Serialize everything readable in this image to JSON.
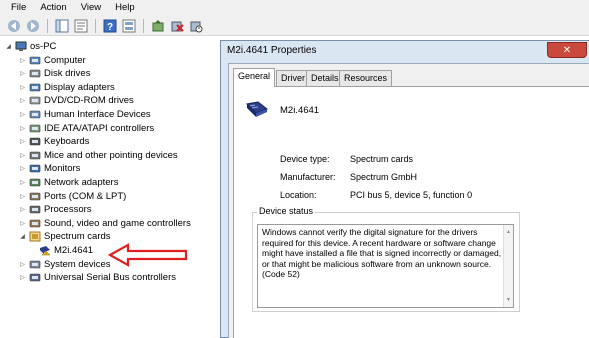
{
  "menubar": {
    "items": [
      "File",
      "Action",
      "View",
      "Help"
    ]
  },
  "toolbar": {
    "buttons": [
      "back-icon",
      "forward-icon",
      "show-hide-tree-icon",
      "properties-icon",
      "help-icon",
      "view-icon",
      "update-driver-icon",
      "uninstall-icon",
      "disable-icon"
    ]
  },
  "tree": {
    "root": "os-PC",
    "items": [
      {
        "label": "Computer",
        "icon": "computer-icon",
        "expanded": false
      },
      {
        "label": "Disk drives",
        "icon": "disk-drive-icon",
        "expanded": false
      },
      {
        "label": "Display adapters",
        "icon": "display-adapter-icon",
        "expanded": false
      },
      {
        "label": "DVD/CD-ROM drives",
        "icon": "dvd-drive-icon",
        "expanded": false
      },
      {
        "label": "Human Interface Devices",
        "icon": "hid-icon",
        "expanded": false
      },
      {
        "label": "IDE ATA/ATAPI controllers",
        "icon": "ide-controller-icon",
        "expanded": false
      },
      {
        "label": "Keyboards",
        "icon": "keyboard-icon",
        "expanded": false
      },
      {
        "label": "Mice and other pointing devices",
        "icon": "mouse-icon",
        "expanded": false
      },
      {
        "label": "Monitors",
        "icon": "monitor-icon",
        "expanded": false
      },
      {
        "label": "Network adapters",
        "icon": "network-adapter-icon",
        "expanded": false
      },
      {
        "label": "Ports (COM & LPT)",
        "icon": "port-icon",
        "expanded": false
      },
      {
        "label": "Processors",
        "icon": "processor-icon",
        "expanded": false
      },
      {
        "label": "Sound, video and game controllers",
        "icon": "sound-icon",
        "expanded": false
      },
      {
        "label": "Spectrum cards",
        "icon": "spectrum-card-icon",
        "expanded": true
      },
      {
        "label": "M2i.4641",
        "icon": "warning-device-icon",
        "child": true
      },
      {
        "label": "System devices",
        "icon": "system-device-icon",
        "expanded": false
      },
      {
        "label": "Universal Serial Bus controllers",
        "icon": "usb-icon",
        "expanded": false
      }
    ]
  },
  "dialog": {
    "title": "M2i.4641 Properties",
    "close_label": "✕",
    "tabs": [
      "General",
      "Driver",
      "Details",
      "Resources"
    ],
    "active_tab": "General",
    "device_name": "M2i.4641",
    "properties": [
      {
        "label": "Device type:",
        "value": "Spectrum cards"
      },
      {
        "label": "Manufacturer:",
        "value": "Spectrum GmbH"
      },
      {
        "label": "Location:",
        "value": "PCI bus 5, device 5, function 0"
      }
    ],
    "status_legend": "Device status",
    "status_text": "Windows cannot verify the digital signature for the drivers required for this device. A recent hardware or software change might have installed a file that is signed incorrectly or damaged, or that might be malicious software from an unknown source. (Code 52)"
  },
  "colors": {
    "annotation_arrow": "#e02020",
    "dialog_frame": "#dbe6f3",
    "close_button": "#c94a3c"
  }
}
